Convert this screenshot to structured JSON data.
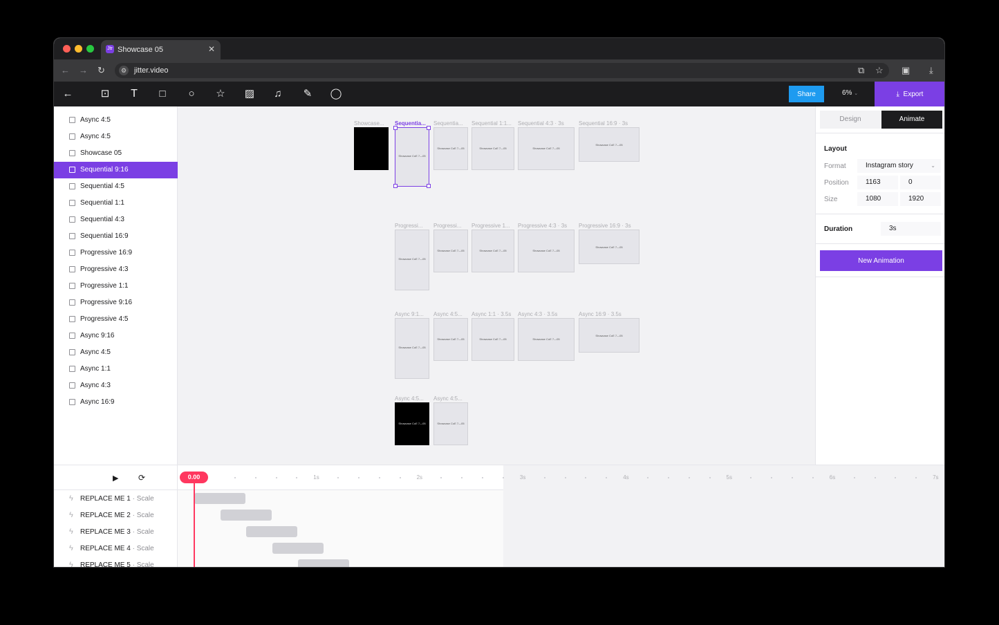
{
  "browser": {
    "tab_title": "Showcase 05",
    "tab_favicon": "Jtr",
    "url": "jitter.video",
    "colors": {
      "traffic_red": "#fe5f57",
      "traffic_yellow": "#febc2e",
      "traffic_green": "#28c840"
    }
  },
  "toolbar": {
    "share_label": "Share",
    "zoom_label": "6%",
    "export_label": "Export"
  },
  "sidebar": {
    "items": [
      {
        "label": "Async 4:5",
        "active": false
      },
      {
        "label": "Async 4:5",
        "active": false
      },
      {
        "label": "Showcase 05",
        "active": false
      },
      {
        "label": "Sequential 9:16",
        "active": true
      },
      {
        "label": "Sequential 4:5",
        "active": false
      },
      {
        "label": "Sequential 1:1",
        "active": false
      },
      {
        "label": "Sequential 4:3",
        "active": false
      },
      {
        "label": "Sequential 16:9",
        "active": false
      },
      {
        "label": "Progressive 16:9",
        "active": false
      },
      {
        "label": "Progressive 4:3",
        "active": false
      },
      {
        "label": "Progressive 1:1",
        "active": false
      },
      {
        "label": "Progressive 9:16",
        "active": false
      },
      {
        "label": "Progressive 4:5",
        "active": false
      },
      {
        "label": "Async 9:16",
        "active": false
      },
      {
        "label": "Async 4:5",
        "active": false
      },
      {
        "label": "Async 1:1",
        "active": false
      },
      {
        "label": "Async 4:3",
        "active": false
      },
      {
        "label": "Async 16:9",
        "active": false
      }
    ]
  },
  "canvas": {
    "artboards": [
      {
        "label": "Showcase...",
        "text": "",
        "dark": true,
        "selected": false
      },
      {
        "label": "Sequentia...",
        "text": "Showcase CoE 7—05",
        "dark": false,
        "selected": true
      },
      {
        "label": "Sequentia...",
        "text": "Showcase CoE 7—05",
        "dark": false,
        "selected": false
      },
      {
        "label": "Sequential 1:1...",
        "text": "Showcase CoE 7—05",
        "dark": false,
        "selected": false
      },
      {
        "label": "Sequential 4:3 · 3s",
        "text": "Showcase CoE 7—05",
        "dark": false,
        "selected": false
      },
      {
        "label": "Sequential 16:9 · 3s",
        "text": "Showcase CoE 7—05",
        "dark": false,
        "selected": false
      },
      {
        "label": "Progressi...",
        "text": "Showcase CoE 7—05",
        "dark": false,
        "selected": false
      },
      {
        "label": "Progressi...",
        "text": "Showcase CoE 7—05",
        "dark": false,
        "selected": false
      },
      {
        "label": "Progressive 1...",
        "text": "Showcase CoE 7—05",
        "dark": false,
        "selected": false
      },
      {
        "label": "Progressive 4:3 · 3s",
        "text": "Showcase CoE 7—05",
        "dark": false,
        "selected": false
      },
      {
        "label": "Progressive 16:9 · 3s",
        "text": "Showcase CoE 7—05",
        "dark": false,
        "selected": false
      },
      {
        "label": "Async 9:1...",
        "text": "Showcase CoE 7—05",
        "dark": false,
        "selected": false
      },
      {
        "label": "Async 4:5...",
        "text": "Showcase CoE 7—05",
        "dark": false,
        "selected": false
      },
      {
        "label": "Async 1:1 · 3.5s",
        "text": "Showcase CoE 7—05",
        "dark": false,
        "selected": false
      },
      {
        "label": "Async 4:3 · 3.5s",
        "text": "Showcase CoE 7—05",
        "dark": false,
        "selected": false
      },
      {
        "label": "Async 16:9 · 3.5s",
        "text": "Showcase CoE 7—05",
        "dark": false,
        "selected": false
      },
      {
        "label": "Async 4:5...",
        "text": "Showcase CoE 7—05",
        "dark": true,
        "selected": false
      },
      {
        "label": "Async 4:5...",
        "text": "Showcase CoE 7—05",
        "dark": false,
        "selected": false
      }
    ]
  },
  "panel": {
    "tab_design": "Design",
    "tab_animate": "Animate",
    "layout_title": "Layout",
    "format_label": "Format",
    "format_value": "Instagram story",
    "position_label": "Position",
    "position_x": "1163",
    "position_y": "0",
    "size_label": "Size",
    "size_w": "1080",
    "size_h": "1920",
    "duration_title": "Duration",
    "duration_value": "3s",
    "new_animation_label": "New Animation"
  },
  "timeline": {
    "current_time": "0.00",
    "ruler_labels": [
      "1s",
      "2s",
      "3s",
      "4s",
      "5s",
      "6s",
      "7s"
    ],
    "tracks": [
      {
        "name": "REPLACE ME 1",
        "type": "· Scale"
      },
      {
        "name": "REPLACE ME 2",
        "type": "· Scale"
      },
      {
        "name": "REPLACE ME 3",
        "type": "· Scale"
      },
      {
        "name": "REPLACE ME 4",
        "type": "· Scale"
      },
      {
        "name": "REPLACE ME 5",
        "type": "· Scale"
      }
    ]
  },
  "colors": {
    "accent": "#7b3fe4",
    "share": "#1e9bf0",
    "playhead": "#ff375f"
  }
}
